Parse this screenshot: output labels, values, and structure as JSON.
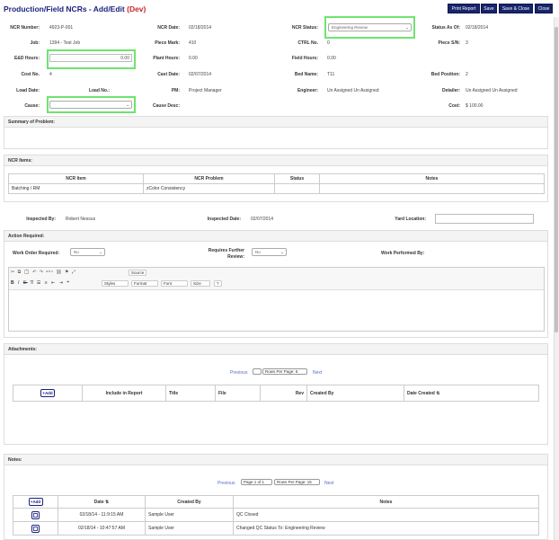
{
  "header": {
    "title": "Production/Field NCRs - Add/Edit",
    "env": "(Dev)",
    "buttons": {
      "print": "Print Report",
      "save": "Save",
      "save_close": "Save & Close",
      "close": "Close"
    }
  },
  "form": {
    "ncr_number": {
      "label": "NCR Number:",
      "value": "4923-P-001"
    },
    "ncr_date": {
      "label": "NCR Date:",
      "value": "02/18/2014"
    },
    "ncr_status": {
      "label": "NCR Status:",
      "value": "Engineering Review"
    },
    "status_as_of": {
      "label": "Status As Of:",
      "value": "02/18/2014"
    },
    "job": {
      "label": "Job:",
      "value": "1394 - Test Job"
    },
    "piece_mark": {
      "label": "Piece Mark:",
      "value": "410"
    },
    "ctrl_no": {
      "label": "CTRL No.",
      "value": "0"
    },
    "piece_sn": {
      "label": "Piece S/N:",
      "value": "3"
    },
    "ed_hours": {
      "label": "E&D Hours:",
      "value": "0.00"
    },
    "plant_hours": {
      "label": "Plant Hours:",
      "value": "0.00"
    },
    "field_hours": {
      "label": "Field Hours:",
      "value": "0.00"
    },
    "cost_no": {
      "label": "Cost No.",
      "value": "4"
    },
    "cast_date": {
      "label": "Cast Date:",
      "value": "02/07/2014"
    },
    "bed_name": {
      "label": "Bed Name:",
      "value": "T11"
    },
    "bed_position": {
      "label": "Bed Position:",
      "value": "2"
    },
    "load_date": {
      "label": "Load Date:",
      "value": ""
    },
    "load_no": {
      "label": "Load No.:",
      "value": ""
    },
    "pm": {
      "label": "PM:",
      "value": "Project Manager"
    },
    "engineer": {
      "label": "Engineer:",
      "value": "Un Assigned Un Assigned"
    },
    "detailer": {
      "label": "Detailer:",
      "value": "Un Assigned Un Assigned"
    },
    "cause": {
      "label": "Cause:",
      "value": ""
    },
    "cause_desc": {
      "label": "Cause Desc:",
      "value": ""
    },
    "cost": {
      "label": "Cost:",
      "value": "$ 100.00"
    }
  },
  "summary": {
    "title": "Summary of Problem:"
  },
  "ncr_items": {
    "title": "NCR Items:",
    "columns": [
      "NCR Item",
      "NCR Problem",
      "Status",
      "Notes"
    ],
    "rows": [
      [
        "Batching / RM",
        "zColor Consistency",
        "",
        ""
      ]
    ]
  },
  "inspection": {
    "inspected_by_label": "Inspected By:",
    "inspected_by": "Robert Nessus",
    "inspected_date_label": "Inspected Date:",
    "inspected_date": "02/07/2014",
    "yard_location_label": "Yard Location:",
    "yard_location": ""
  },
  "action": {
    "title": "Action Required:",
    "work_order_label": "Work Order Required:",
    "work_order": "No",
    "further_review_label": "Requires Further Review:",
    "further_review": "No",
    "work_performed_label": "Work Performed By:",
    "toolbar": {
      "source": "Source",
      "styles": "Styles",
      "format": "Format",
      "font": "Font",
      "size": "Size",
      "help": "?"
    }
  },
  "attachments": {
    "title": "Attachments:",
    "prev": "Previous",
    "next": "Next",
    "page_value": "",
    "rows_per_page": "Rows Per Page: 5",
    "add": "Add",
    "columns": [
      "Include in Report",
      "Title",
      "File",
      "Rev",
      "Created By",
      "Date Created"
    ]
  },
  "notes": {
    "title": "Notes:",
    "prev": "Previous",
    "next": "Next",
    "page_value": "Page 1 of 1",
    "rows_per_page": "Rows Per Page: 15",
    "add": "Add",
    "columns": [
      "Date",
      "Created By",
      "Notes"
    ],
    "rows": [
      [
        "02/18/14 - 11:9:15 AM",
        "Sample User",
        "QC Closed"
      ],
      [
        "02/18/14 - 10:47:57 AM",
        "Sample User",
        "Changed QC Status To: Engineering Review"
      ]
    ]
  }
}
